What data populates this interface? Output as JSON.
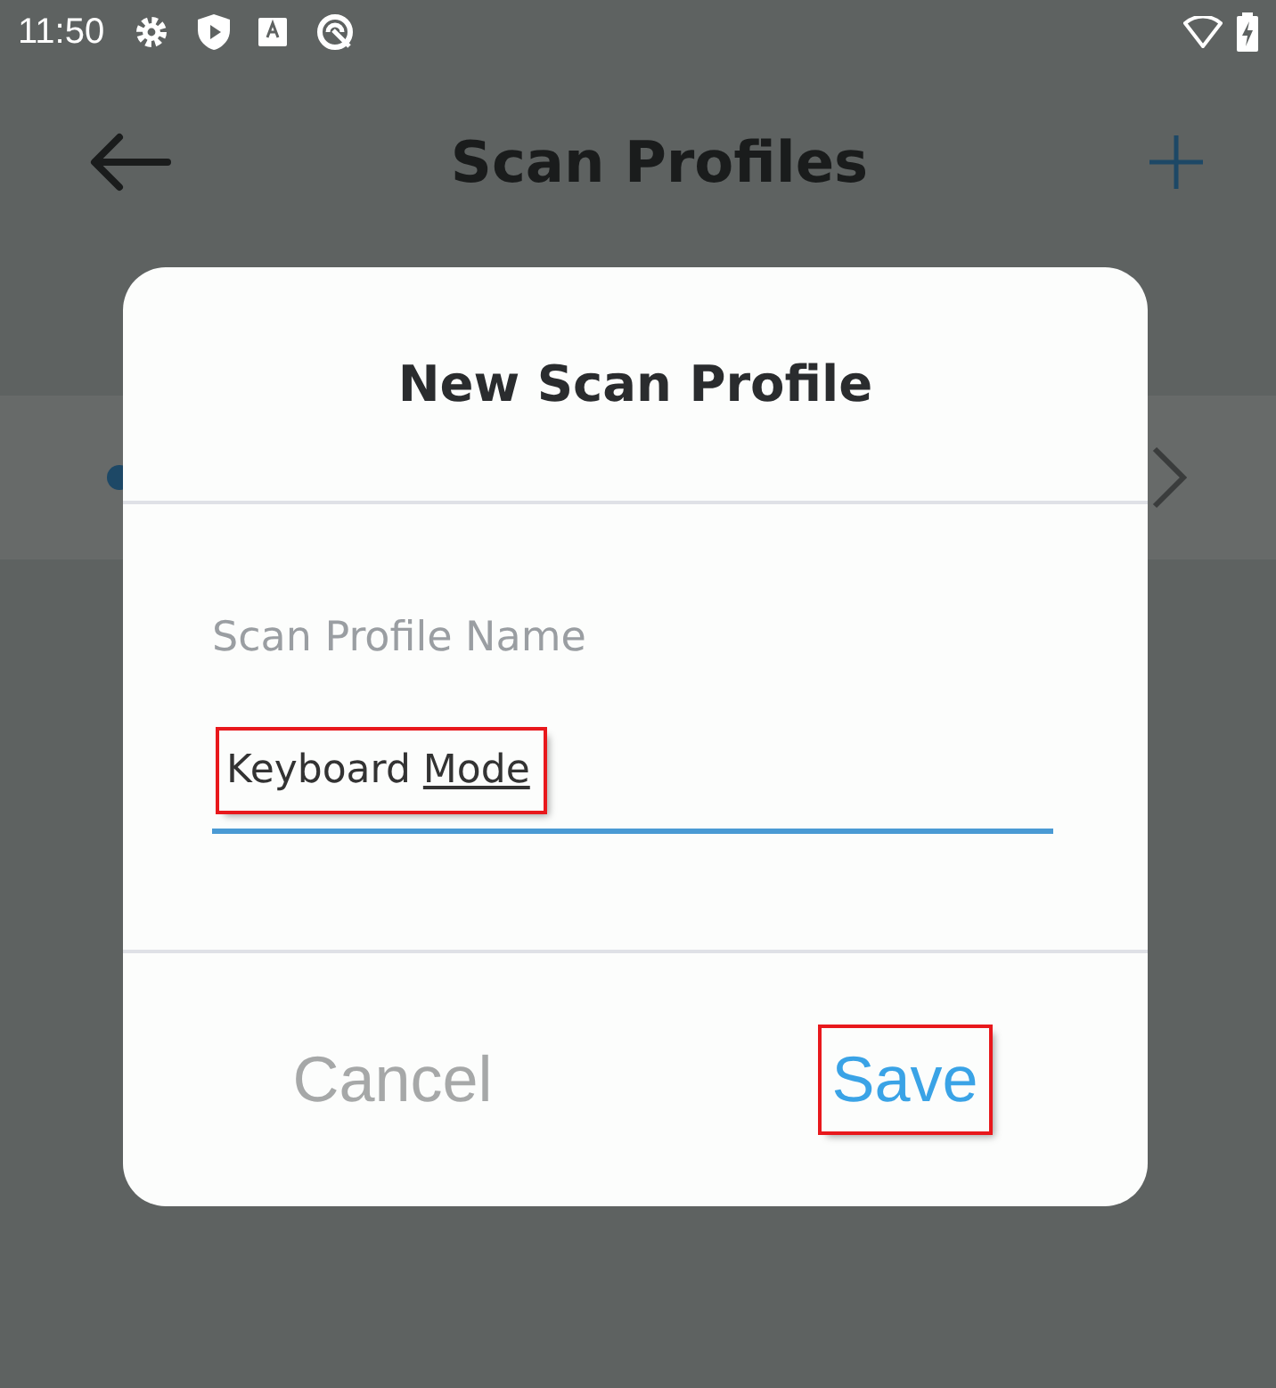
{
  "status_bar": {
    "time": "11:50"
  },
  "app_bar": {
    "title": "Scan Profiles"
  },
  "dialog": {
    "title": "New Scan Profile",
    "field": {
      "label": "Scan Profile Name",
      "value_parts": [
        {
          "text": "Keyboard ",
          "underlined": false
        },
        {
          "text": "Mode",
          "underlined": true
        }
      ],
      "focused": true,
      "highlighted": true
    },
    "buttons": [
      {
        "label": "Cancel",
        "kind": "secondary",
        "highlighted": false
      },
      {
        "label": "Save",
        "kind": "primary",
        "highlighted": true
      }
    ]
  }
}
